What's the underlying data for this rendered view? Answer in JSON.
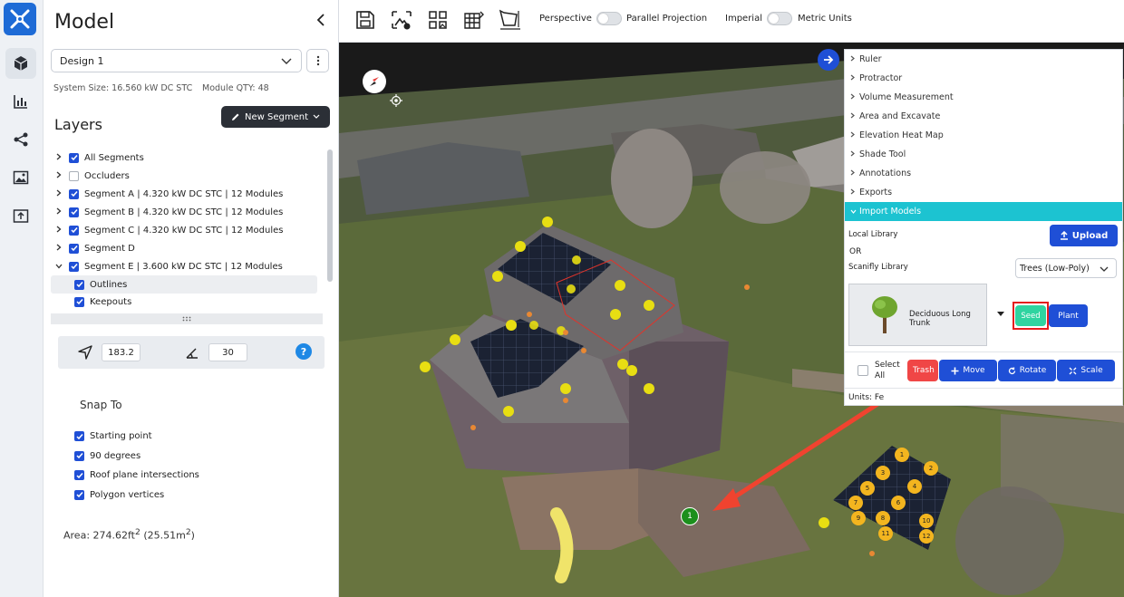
{
  "panel": {
    "title": "Model",
    "design_select": "Design 1",
    "system_size": "System Size: 16.560 kW DC STC",
    "module_qty": "Module QTY: 48",
    "layers_title": "Layers",
    "new_segment_label": "New Segment"
  },
  "layers": [
    {
      "label": "All Segments",
      "checked": true,
      "expanded": false
    },
    {
      "label": "Occluders",
      "checked": false,
      "expanded": false
    },
    {
      "label": "Segment A | 4.320 kW DC STC | 12 Modules",
      "checked": true,
      "expanded": false
    },
    {
      "label": "Segment B | 4.320 kW DC STC | 12 Modules",
      "checked": true,
      "expanded": false
    },
    {
      "label": "Segment C | 4.320 kW DC STC | 12 Modules",
      "checked": true,
      "expanded": false
    },
    {
      "label": "Segment D",
      "checked": true,
      "expanded": false
    },
    {
      "label": "Segment E | 3.600 kW DC STC | 12 Modules",
      "checked": true,
      "expanded": true
    }
  ],
  "layer_children": [
    {
      "label": "Outlines",
      "checked": true
    },
    {
      "label": "Keepouts",
      "checked": true
    }
  ],
  "azimuth": {
    "value": "183.2"
  },
  "tilt": {
    "value": "30"
  },
  "help": "?",
  "snap": {
    "title": "Snap To",
    "options": [
      "Starting point",
      "90 degrees",
      "Roof plane intersections",
      "Polygon vertices"
    ]
  },
  "area": {
    "prefix": "Area: 274.62ft",
    "sup1": "2",
    "mid": " (25.51m",
    "sup2": "2",
    "suffix": ")"
  },
  "toolbar": {
    "perspective": "Perspective",
    "parallel": "Parallel Projection",
    "imperial": "Imperial",
    "metric": "Metric Units"
  },
  "tools": {
    "items": [
      "Ruler",
      "Protractor",
      "Volume Measurement",
      "Area and Excavate",
      "Elevation Heat Map",
      "Shade Tool",
      "Annotations",
      "Exports",
      "Import Models"
    ],
    "active": "Import Models",
    "local_library": "Local Library",
    "or": "OR",
    "scanifly_library": "Scanifly Library",
    "upload": "Upload",
    "library_select": "Trees (Low-Poly)",
    "model_name": "Deciduous Long Trunk",
    "seed": "Seed",
    "plant": "Plant",
    "select_all_1": "Select",
    "select_all_2": "All",
    "trash": "Trash",
    "move": "Move",
    "rotate": "Rotate",
    "scale": "Scale",
    "units": "Units: Fe"
  },
  "viewport": {
    "marker": "1",
    "module_numbers": [
      "1",
      "2",
      "3",
      "4",
      "5",
      "6",
      "7",
      "8",
      "9",
      "10",
      "11",
      "12"
    ]
  },
  "colors": {
    "accent": "#1f4fd6",
    "active_tool": "#1cc3d1",
    "seed": "#2fd4a0",
    "highlight": "#e51e1e",
    "trash": "#f04646"
  }
}
